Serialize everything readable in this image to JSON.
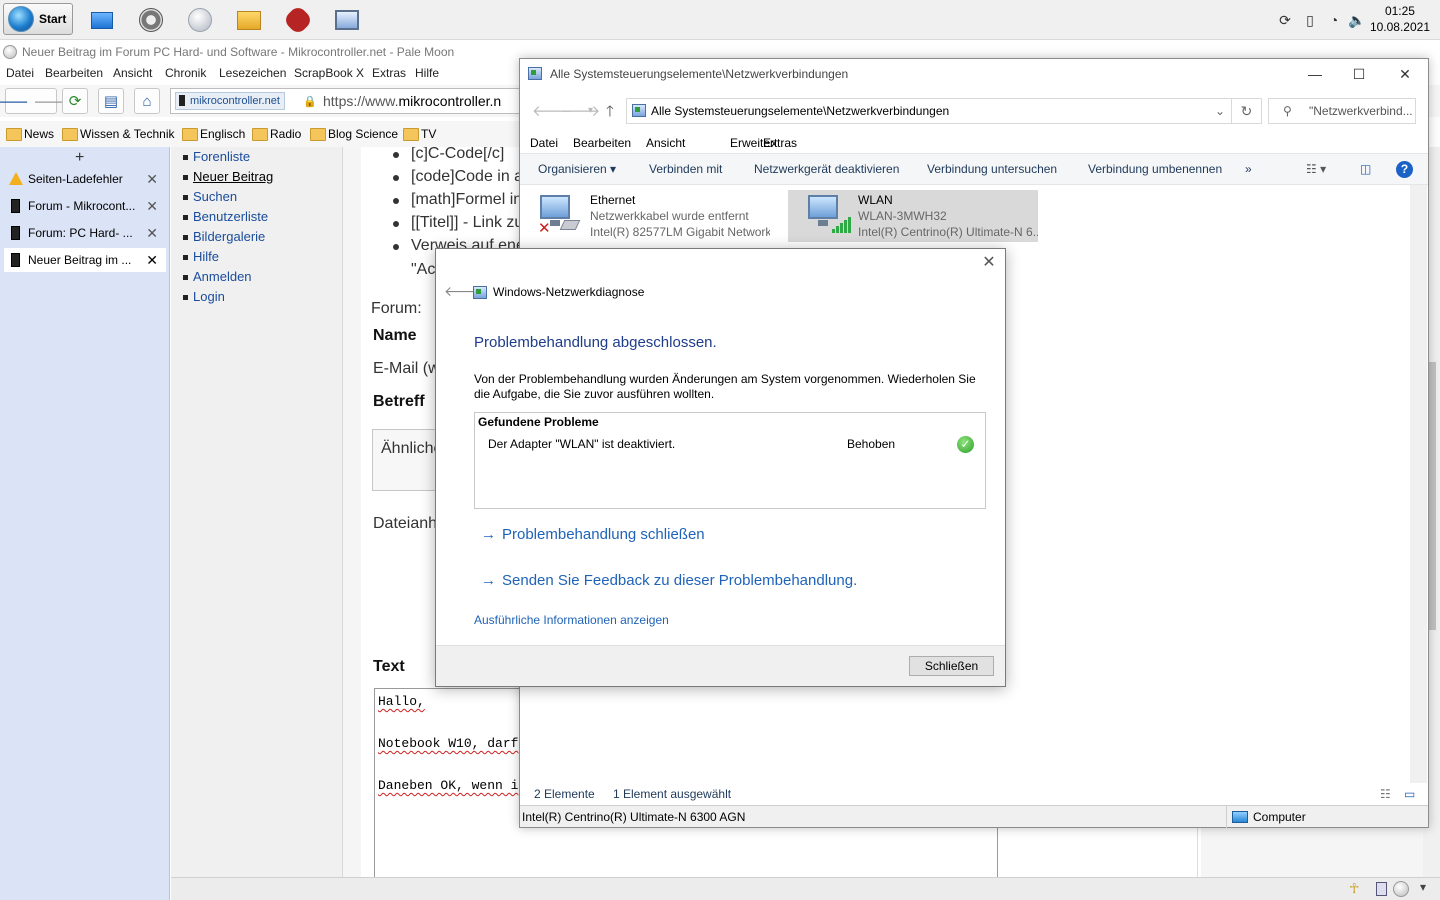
{
  "taskbar": {
    "start_label": "Start",
    "clock_time": "01:25",
    "clock_date": "10.08.2021"
  },
  "browser": {
    "window_title": "Neuer Beitrag im Forum PC Hard- und Software - Mikrocontroller.net - Pale Moon",
    "menu": [
      "Datei",
      "Bearbeiten",
      "Ansicht",
      "Chronik",
      "Lesezeichen",
      "ScrapBook X",
      "Extras",
      "Hilfe"
    ],
    "site_label": "mikrocontroller.net",
    "url_prefix": "https://www.",
    "url_host": "mikrocontroller.n",
    "bookmarks": [
      "News",
      "Wissen & Technik",
      "Englisch",
      "Radio",
      "Blog Science",
      "TV"
    ]
  },
  "sidebar": {
    "tabs": [
      {
        "label": "Seiten-Ladefehler"
      },
      {
        "label": "Forum - Mikrocont..."
      },
      {
        "label": "Forum: PC Hard- ..."
      },
      {
        "label": "Neuer Beitrag im ..."
      }
    ]
  },
  "webpage": {
    "nav": [
      "Forenliste",
      "Neuer Beitrag",
      "Suchen",
      "Benutzerliste",
      "Bildergalerie",
      "Hilfe",
      "Anmelden",
      "Login"
    ],
    "bullets": [
      "[c]C-Code[/c]",
      "[code]Code in a",
      "[math]Formel in",
      "[[Titel]] - Link zu",
      "Verweis auf ene"
    ],
    "bullet_cont": "\"Ac",
    "forum_label": "Forum:",
    "name_label": "Name",
    "email_label": "E-Mail (w",
    "subject_label": "Betreff",
    "similar_label": "Ähnliche",
    "attach_label": "Dateianh",
    "text_label": "Text",
    "textarea_lines": [
      "Hallo,",
      "",
      "Notebook W10, darf",
      "",
      "Daneben OK, wenn i"
    ]
  },
  "explorer": {
    "title": "Alle Systemsteuerungselemente\\Netzwerkverbindungen",
    "address": "Alle Systemsteuerungselemente\\Netzwerkverbindungen",
    "search_placeholder": "\"Netzwerkverbind...",
    "menu": [
      "Datei",
      "Bearbeiten",
      "Ansicht",
      "Erweitert",
      "Extras"
    ],
    "commands": [
      "Organisieren ▾",
      "Verbinden mit",
      "Netzwerkgerät deaktivieren",
      "Verbindung untersuchen",
      "Verbindung umbenennen",
      "»"
    ],
    "adapters": [
      {
        "name": "Ethernet",
        "status": "Netzwerkkabel wurde entfernt",
        "device": "Intel(R) 82577LM Gigabit Network..."
      },
      {
        "name": "WLAN",
        "status": "WLAN-3MWH32",
        "device": "Intel(R) Centrino(R) Ultimate-N 6..."
      }
    ],
    "status_count": "2 Elemente",
    "status_selected": "1 Element ausgewählt",
    "details_device": "Intel(R) Centrino(R) Ultimate-N 6300 AGN",
    "details_location": "Computer"
  },
  "dialog": {
    "title": "Windows-Netzwerkdiagnose",
    "heading": "Problembehandlung abgeschlossen.",
    "description": "Von der Problembehandlung wurden Änderungen am System vorgenommen. Wiederholen Sie die Aufgabe, die Sie zuvor ausführen wollten.",
    "problems_header": "Gefundene Probleme",
    "problem": "Der Adapter \"WLAN\" ist deaktiviert.",
    "problem_state": "Behoben",
    "link_close": "Problembehandlung schließen",
    "link_feedback": "Senden Sie Feedback zu dieser Problembehandlung.",
    "more_info": "Ausführliche Informationen anzeigen",
    "close_button": "Schließen"
  }
}
